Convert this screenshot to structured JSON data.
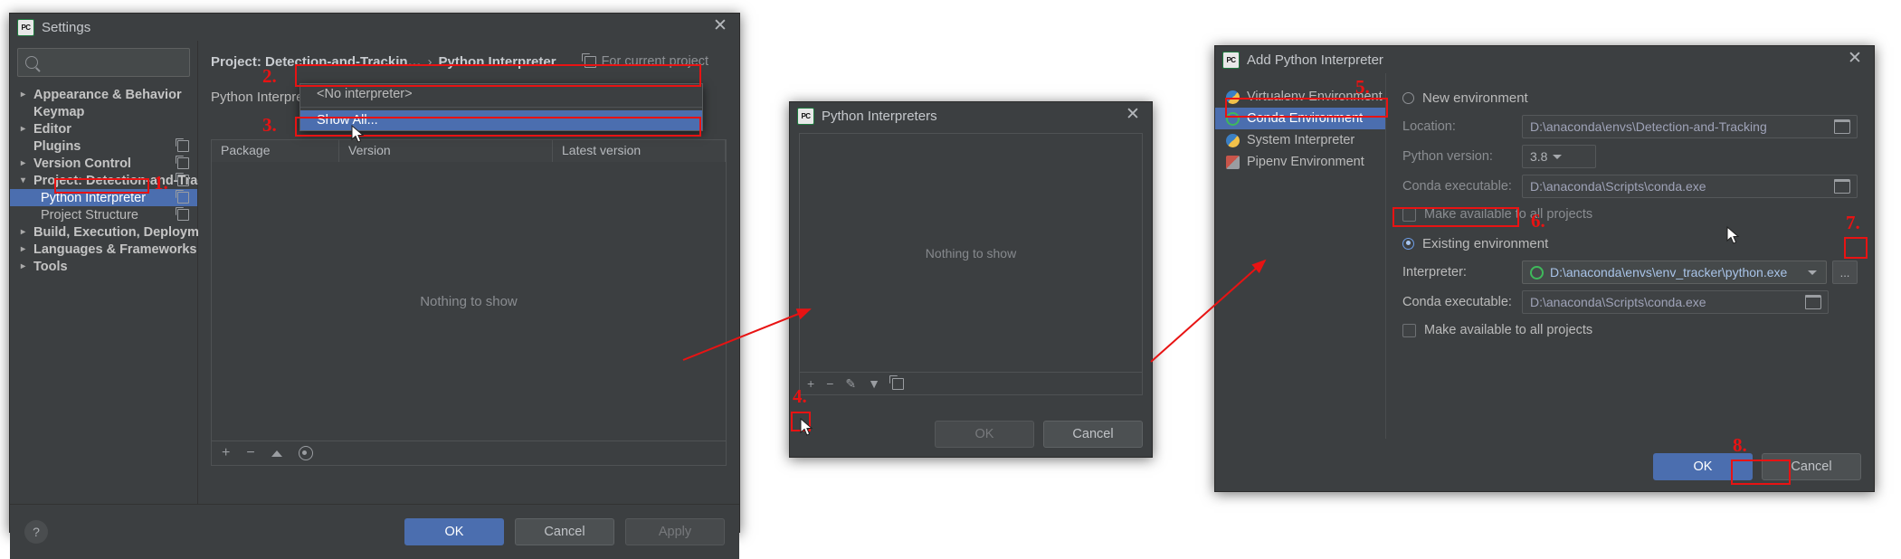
{
  "settings": {
    "title": "Settings",
    "search_placeholder": "",
    "tree": [
      {
        "label": "Appearance & Behavior",
        "arrow": "right",
        "bold": true,
        "child": false,
        "copy": false,
        "selected": false
      },
      {
        "label": "Keymap",
        "arrow": "",
        "bold": true,
        "child": false,
        "copy": false,
        "selected": false
      },
      {
        "label": "Editor",
        "arrow": "right",
        "bold": true,
        "child": false,
        "copy": false,
        "selected": false
      },
      {
        "label": "Plugins",
        "arrow": "",
        "bold": true,
        "child": false,
        "copy": true,
        "selected": false
      },
      {
        "label": "Version Control",
        "arrow": "right",
        "bold": true,
        "child": false,
        "copy": true,
        "selected": false
      },
      {
        "label": "Project: Detection-and-Trackin…",
        "arrow": "down",
        "bold": true,
        "child": false,
        "copy": true,
        "selected": false
      },
      {
        "label": "Python Interpreter",
        "arrow": "",
        "bold": false,
        "child": true,
        "copy": true,
        "selected": true
      },
      {
        "label": "Project Structure",
        "arrow": "",
        "bold": false,
        "child": true,
        "copy": true,
        "selected": false
      },
      {
        "label": "Build, Execution, Deployment",
        "arrow": "right",
        "bold": true,
        "child": false,
        "copy": false,
        "selected": false
      },
      {
        "label": "Languages & Frameworks",
        "arrow": "right",
        "bold": true,
        "child": false,
        "copy": false,
        "selected": false
      },
      {
        "label": "Tools",
        "arrow": "right",
        "bold": true,
        "child": false,
        "copy": false,
        "selected": false
      }
    ],
    "breadcrumb": {
      "project": "Project: Detection-and-Trackin…",
      "separator": "›",
      "page": "Python Interpreter",
      "scope": "For current project"
    },
    "interpreter_row": {
      "label": "Python Interpreter:",
      "value": "<No interpreter>"
    },
    "dropdown": {
      "options": [
        {
          "label": "<No interpreter>",
          "highlighted": false
        },
        {
          "label": "Show All...",
          "highlighted": true
        }
      ]
    },
    "packages": {
      "columns": [
        "Package",
        "Version",
        "Latest version"
      ],
      "empty_text": "Nothing to show",
      "tools": [
        "+",
        "−",
        "up-arrow",
        "eye"
      ]
    },
    "footer": {
      "help": "?",
      "ok": "OK",
      "cancel": "Cancel",
      "apply": "Apply"
    }
  },
  "interpreters_dialog": {
    "title": "Python Interpreters",
    "empty_text": "Nothing to show",
    "tools": [
      "+",
      "−",
      "pencil",
      "filter",
      "copy"
    ],
    "ok": "OK",
    "cancel": "Cancel"
  },
  "add_interpreter": {
    "title": "Add Python Interpreter",
    "env_types": [
      {
        "label": "Virtualenv Environment",
        "icon": "virtualenv-icon",
        "selected": false
      },
      {
        "label": "Conda Environment",
        "icon": "conda-icon",
        "selected": true
      },
      {
        "label": "System Interpreter",
        "icon": "system-interpreter-icon",
        "selected": false
      },
      {
        "label": "Pipenv Environment",
        "icon": "pipenv-icon",
        "selected": false
      }
    ],
    "new_environment": {
      "radio_label": "New environment",
      "selected": false,
      "location_label": "Location:",
      "location_value": "D:\\anaconda\\envs\\Detection-and-Tracking",
      "python_version_label": "Python version:",
      "python_version_value": "3.8",
      "conda_exe_label": "Conda executable:",
      "conda_exe_value": "D:\\anaconda\\Scripts\\conda.exe",
      "make_available_label": "Make available to all projects",
      "make_available_checked": false
    },
    "existing_environment": {
      "radio_label": "Existing environment",
      "selected": true,
      "interpreter_label": "Interpreter:",
      "interpreter_value": "D:\\anaconda\\envs\\env_tracker\\python.exe",
      "browse_label": "...",
      "conda_exe_label": "Conda executable:",
      "conda_exe_value": "D:\\anaconda\\Scripts\\conda.exe",
      "make_available_label": "Make available to all projects",
      "make_available_checked": false
    },
    "ok": "OK",
    "cancel": "Cancel"
  },
  "annotations": {
    "steps": [
      "1.",
      "2.",
      "3.",
      "4.",
      "5.",
      "6.",
      "7.",
      "8."
    ],
    "color": "#e81313"
  }
}
